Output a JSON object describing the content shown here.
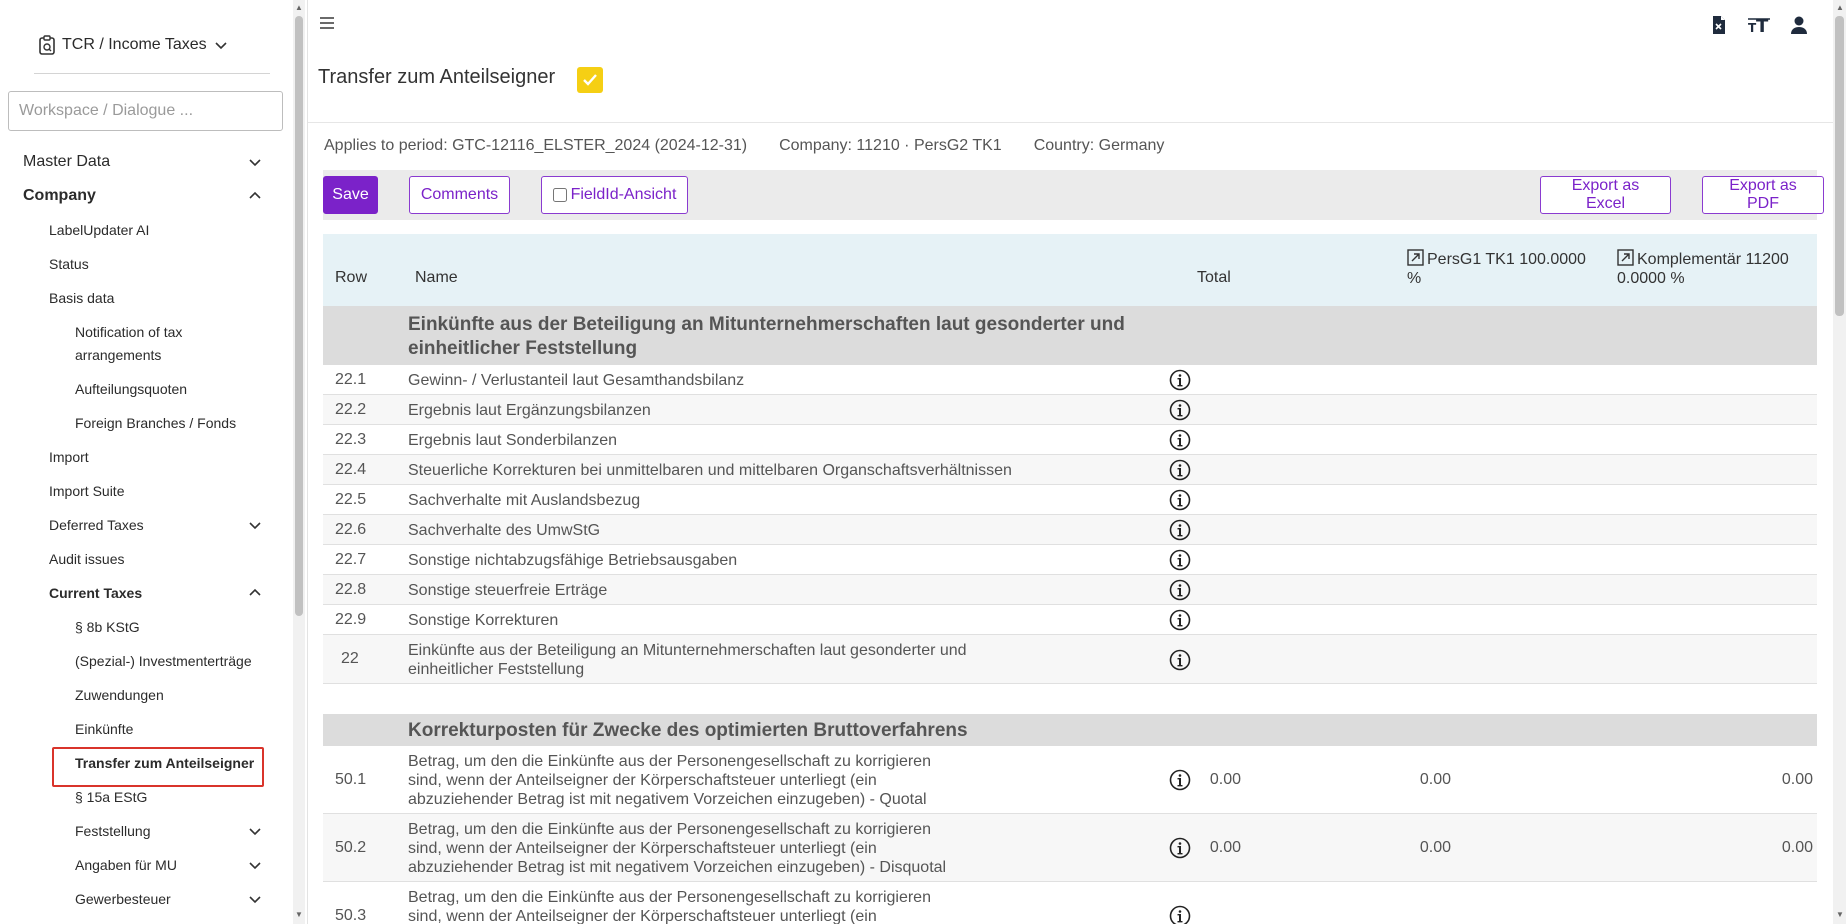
{
  "sidebar": {
    "workspace_title": "TCR / Income Taxes",
    "search_placeholder": "Workspace / Dialogue ...",
    "items": [
      {
        "label": "Master Data"
      },
      {
        "label": "Company"
      },
      {
        "label": "LabelUpdater AI"
      },
      {
        "label": "Status"
      },
      {
        "label": "Basis data"
      },
      {
        "label": "Notification of tax arrangements"
      },
      {
        "label": "Aufteilungsquoten"
      },
      {
        "label": "Foreign Branches / Fonds"
      },
      {
        "label": "Import"
      },
      {
        "label": "Import Suite"
      },
      {
        "label": "Deferred Taxes"
      },
      {
        "label": "Audit issues"
      },
      {
        "label": "Current Taxes"
      },
      {
        "label": "§ 8b KStG"
      },
      {
        "label": "(Spezial-) Investmenterträge"
      },
      {
        "label": "Zuwendungen"
      },
      {
        "label": "Einkünfte"
      },
      {
        "label": "Transfer zum Anteilseigner"
      },
      {
        "label": "§ 15a EStG"
      },
      {
        "label": "Feststellung"
      },
      {
        "label": "Angaben für MU"
      },
      {
        "label": "Gewerbesteuer"
      }
    ]
  },
  "header": {
    "page_title": "Transfer zum Anteilseigner",
    "icons": [
      "file-export-icon",
      "font-size-icon",
      "user-icon"
    ]
  },
  "meta": {
    "period": "Applies to period: GTC-12116_ELSTER_2024 (2024-12-31)",
    "company": "Company: 11210 · PersG2 TK1",
    "country": "Country: Germany"
  },
  "toolbar": {
    "save_label": "Save",
    "comments_label": "Comments",
    "fieldid_label": "FieldId-Ansicht",
    "export_excel_label": "Export as Excel",
    "export_pdf_label": "Export as PDF"
  },
  "table": {
    "headers": {
      "row": "Row",
      "name": "Name",
      "total": "Total",
      "col1": "PersG1 TK1 100.0000 %",
      "col2": "Komplementär 11200 0.0000 %"
    },
    "section1": "Einkünfte aus der Beteiligung an Mitunternehmerschaften laut gesonderter und einheitlicher Feststellung",
    "rows1": [
      {
        "num": "22.1",
        "name": "Gewinn- / Verlustanteil laut Gesamthandsbilanz"
      },
      {
        "num": "22.2",
        "name": "Ergebnis laut Ergänzungsbilanzen"
      },
      {
        "num": "22.3",
        "name": "Ergebnis laut Sonderbilanzen"
      },
      {
        "num": "22.4",
        "name": "Steuerliche Korrekturen bei unmittelbaren und mittelbaren Organschaftsverhältnissen"
      },
      {
        "num": "22.5",
        "name": "Sachverhalte mit Auslandsbezug"
      },
      {
        "num": "22.6",
        "name": "Sachverhalte des UmwStG"
      },
      {
        "num": "22.7",
        "name": "Sonstige nichtabzugsfähige Betriebsausgaben"
      },
      {
        "num": "22.8",
        "name": "Sonstige steuerfreie Erträge"
      },
      {
        "num": "22.9",
        "name": "Sonstige Korrekturen"
      },
      {
        "num": "22",
        "name": "Einkünfte aus der Beteiligung an Mitunternehmerschaften laut gesonderter und einheitlicher Feststellung"
      }
    ],
    "section2": "Korrekturposten für Zwecke des optimierten Bruttoverfahrens",
    "rows2": [
      {
        "num": "50.1",
        "name": "Betrag, um den die Einkünfte aus der Personengesellschaft zu korrigieren sind, wenn der Anteilseigner der Körperschaftsteuer unterliegt (ein abzuziehender Betrag ist mit negativem Vorzeichen einzugeben) - Quotal",
        "total": "0.00",
        "v1": "0.00",
        "v2": "0.00"
      },
      {
        "num": "50.2",
        "name": "Betrag, um den die Einkünfte aus der Personengesellschaft zu korrigieren sind, wenn der Anteilseigner der Körperschaftsteuer unterliegt (ein abzuziehender Betrag ist mit negativem Vorzeichen einzugeben) - Disquotal",
        "total": "0.00",
        "v1": "0.00",
        "v2": "0.00"
      },
      {
        "num": "50.3",
        "name": "Betrag, um den die Einkünfte aus der Personengesellschaft zu korrigieren sind, wenn der Anteilseigner der Körperschaftsteuer unterliegt (ein abzuziehender Betrag ist mit negativem"
      }
    ]
  },
  "colors": {
    "accent": "#7b22c9",
    "badge": "#f5cf14",
    "active_outline": "#d9342b",
    "table_header_bg": "#e6f2f6",
    "section_bg": "#dcdcdc"
  }
}
